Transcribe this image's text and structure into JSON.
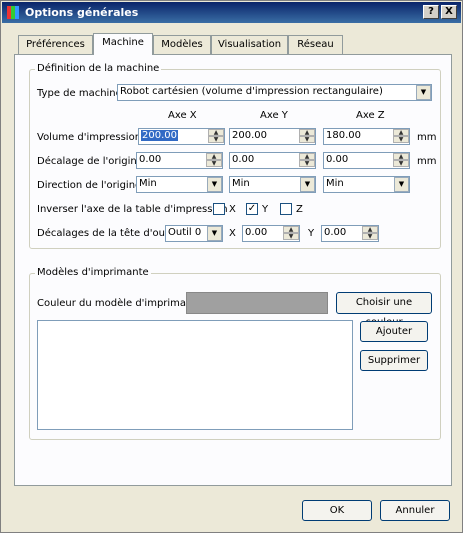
{
  "window": {
    "title": "Options générales"
  },
  "titlebar_buttons": {
    "help": "?",
    "close": "X"
  },
  "tabs": [
    {
      "label": "Préférences"
    },
    {
      "label": "Machine",
      "active": true
    },
    {
      "label": "Modèles"
    },
    {
      "label": "Visualisation"
    },
    {
      "label": "Réseau"
    }
  ],
  "machine": {
    "group_title": "Définition de la machine",
    "type_label": "Type de machine",
    "type_value": "Robot cartésien (volume d'impression rectangulaire)",
    "axes": {
      "x": "Axe X",
      "y": "Axe Y",
      "z": "Axe Z"
    },
    "volume": {
      "label": "Volume d'impression",
      "x": "200.00",
      "y": "200.00",
      "z": "180.00",
      "unit": "mm"
    },
    "offset": {
      "label": "Décalage de l'origine",
      "x": "0.00",
      "y": "0.00",
      "z": "0.00",
      "unit": "mm"
    },
    "direction": {
      "label": "Direction de l'origine",
      "x": "Min",
      "y": "Min",
      "z": "Min"
    },
    "invert": {
      "label": "Inverser l'axe de la table d'impression",
      "x_label": "X",
      "x_checked": false,
      "y_label": "Y",
      "y_checked": true,
      "z_label": "Z",
      "z_checked": false
    },
    "tool_offset": {
      "label": "Décalages de la tête d'outil",
      "tool": "Outil 0",
      "x_label": "X",
      "x": "0.00",
      "y_label": "Y",
      "y": "0.00"
    }
  },
  "printer_models": {
    "group_title": "Modèles d'imprimante",
    "color_label": "Couleur du modèle d'imprimante",
    "color_value": "#a0a0a0",
    "choose_color_button": "Choisir une couleur",
    "add_button": "Ajouter",
    "remove_button": "Supprimer",
    "items": []
  },
  "footer": {
    "ok": "OK",
    "cancel": "Annuler"
  }
}
